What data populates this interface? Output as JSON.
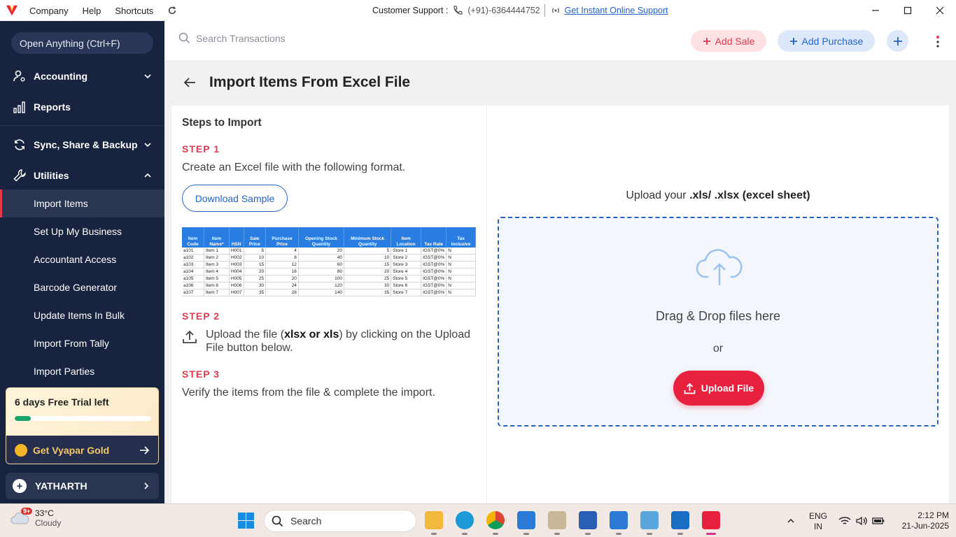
{
  "titlebar": {
    "menu": [
      "Company",
      "Help",
      "Shortcuts"
    ],
    "support_label": "Customer Support :",
    "phone": "(+91)-6364444752",
    "support_link": "Get Instant Online Support"
  },
  "sidebar": {
    "open_anything": "Open Anything (Ctrl+F)",
    "sections": {
      "accounting": "Accounting",
      "reports": "Reports",
      "sync": "Sync, Share & Backup",
      "utilities": "Utilities"
    },
    "utilities_items": [
      "Import Items",
      "Set Up My Business",
      "Accountant Access",
      "Barcode Generator",
      "Update Items In Bulk",
      "Import From Tally",
      "Import Parties"
    ],
    "trial_text": "6 days Free Trial left",
    "trial_progress": 0.12,
    "gold_label": "Get Vyapar Gold",
    "profile_name": "YATHARTH"
  },
  "topbar": {
    "search_placeholder": "Search Transactions",
    "add_sale": "Add Sale",
    "add_purchase": "Add Purchase"
  },
  "page": {
    "title": "Import Items From Excel File"
  },
  "steps": {
    "heading": "Steps to Import",
    "step1_label": "STEP 1",
    "step1_text": "Create an Excel file with the following format.",
    "download_sample": "Download Sample",
    "step2_label": "STEP 2",
    "step2_pre": "Upload the file (",
    "step2_bold": "xlsx or xls",
    "step2_post": ") by clicking on the Upload File button below.",
    "step3_label": "STEP 3",
    "step3_text": "Verify the items from the file & complete the import."
  },
  "sample_table": {
    "headers": [
      "Item Code",
      "Item Name*",
      "HSN",
      "Sale Price",
      "Purchase Price",
      "Opening Stock Quantity",
      "Minimum Stock Quantity",
      "Item Location",
      "Tax Rate",
      "Tax Inclusive"
    ],
    "rows": [
      [
        "a101",
        "Item 1",
        "H001",
        "5",
        "4",
        "20",
        "5",
        "Store 1",
        "IGST@0%",
        "N"
      ],
      [
        "a102",
        "Item 2",
        "H002",
        "10",
        "8",
        "40",
        "10",
        "Store 2",
        "IGST@0%",
        "N"
      ],
      [
        "a103",
        "Item 3",
        "H003",
        "15",
        "12",
        "60",
        "15",
        "Store 3",
        "IGST@0%",
        "N"
      ],
      [
        "a104",
        "Item 4",
        "H004",
        "20",
        "16",
        "80",
        "20",
        "Store 4",
        "IGST@0%",
        "N"
      ],
      [
        "a105",
        "Item 5",
        "H005",
        "25",
        "20",
        "100",
        "25",
        "Store 5",
        "IGST@0%",
        "N"
      ],
      [
        "a106",
        "Item 6",
        "H006",
        "30",
        "24",
        "120",
        "30",
        "Store 6",
        "IGST@0%",
        "N"
      ],
      [
        "a107",
        "Item 7",
        "H007",
        "35",
        "28",
        "140",
        "35",
        "Store 7",
        "IGST@0%",
        "N"
      ]
    ]
  },
  "upload": {
    "title_pre": "Upload your ",
    "title_bold": ".xls/ .xlsx (excel sheet)",
    "drag_text": "Drag & Drop files here",
    "or_text": "or",
    "button": "Upload File"
  },
  "taskbar": {
    "temperature": "33°C",
    "condition": "Cloudy",
    "badge": "9+",
    "search": "Search",
    "lang1": "ENG",
    "lang2": "IN",
    "time": "2:12 PM",
    "date": "21-Jun-2025"
  },
  "colors": {
    "sidebar_bg": "#18233f",
    "accent_red": "#e33a4d",
    "accent_blue": "#2563c7",
    "trial_green": "#1aa46a"
  }
}
